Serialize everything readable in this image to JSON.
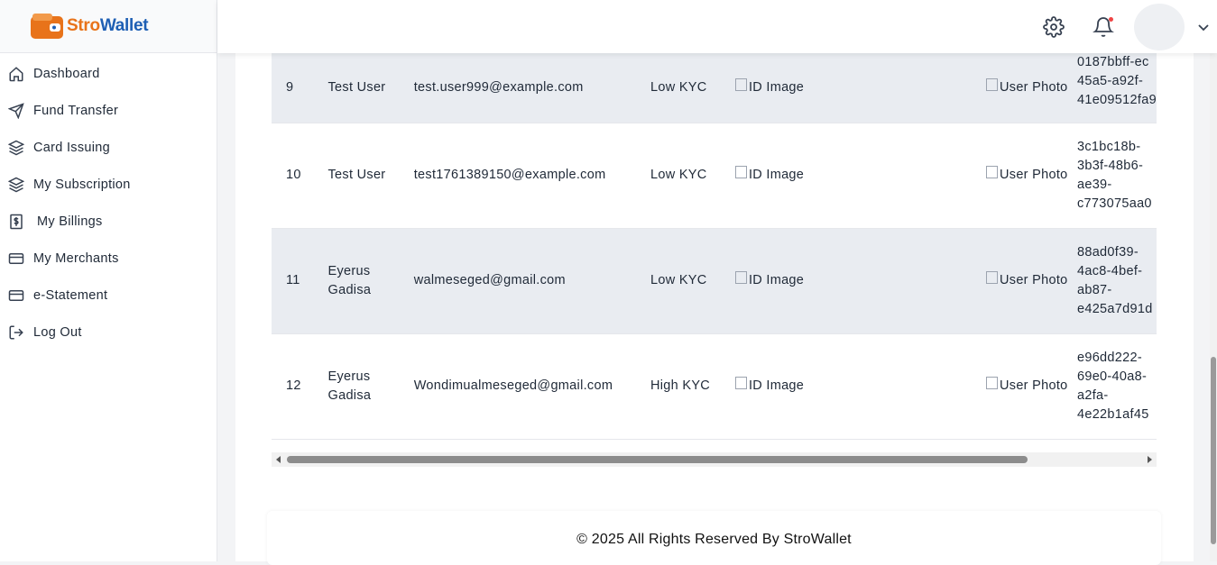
{
  "brand": {
    "name_part1": "Stro",
    "name_part2": "Wallet",
    "color1": "#e8731a",
    "color2": "#1e5fb4"
  },
  "sidebar": {
    "items": [
      {
        "label": "Dashboard",
        "icon": "home-icon"
      },
      {
        "label": "Fund Transfer",
        "icon": "send-icon"
      },
      {
        "label": "Card Issuing",
        "icon": "layers-icon"
      },
      {
        "label": "My Subscription",
        "icon": "layers-icon"
      },
      {
        "label": "My Billings",
        "icon": "dollar-icon"
      },
      {
        "label": "My Merchants",
        "icon": "card-icon"
      },
      {
        "label": "e-Statement",
        "icon": "card-icon"
      },
      {
        "label": "Log Out",
        "icon": "logout-icon"
      }
    ]
  },
  "topbar": {
    "icons": [
      "gear-icon",
      "bell-icon",
      "avatar",
      "chevron-down-icon"
    ]
  },
  "table": {
    "rows": [
      {
        "id": "9",
        "name": "Test User",
        "email": "test.user999@example.com",
        "kyc": "Low KYC",
        "id_image": "ID Image",
        "photo": "User Photo",
        "uuid": "0187bbff-ec\n45a5-a92f-\n41e09512fa9"
      },
      {
        "id": "10",
        "name": "Test User",
        "email": "test1761389150@example.com",
        "kyc": "Low KYC",
        "id_image": "ID Image",
        "photo": "User Photo",
        "uuid": "3c1bc18b-\n3b3f-48b6-\nae39-\nc773075aa0"
      },
      {
        "id": "11",
        "name": "Eyerus Gadisa",
        "email": "walmeseged@gmail.com",
        "kyc": "Low KYC",
        "id_image": "ID Image",
        "photo": "User Photo",
        "uuid": "88ad0f39-\n4ac8-4bef-\nab87-\ne425a7d91d"
      },
      {
        "id": "12",
        "name": "Eyerus Gadisa",
        "email": "Wondimualmeseged@gmail.com",
        "kyc": "High KYC",
        "id_image": "ID Image",
        "photo": "User Photo",
        "uuid": "e96dd222-\n69e0-40a8-\na2fa-\n4e22b1af45"
      }
    ]
  },
  "footer": {
    "text": "© 2025 All Rights Reserved By StroWallet"
  }
}
